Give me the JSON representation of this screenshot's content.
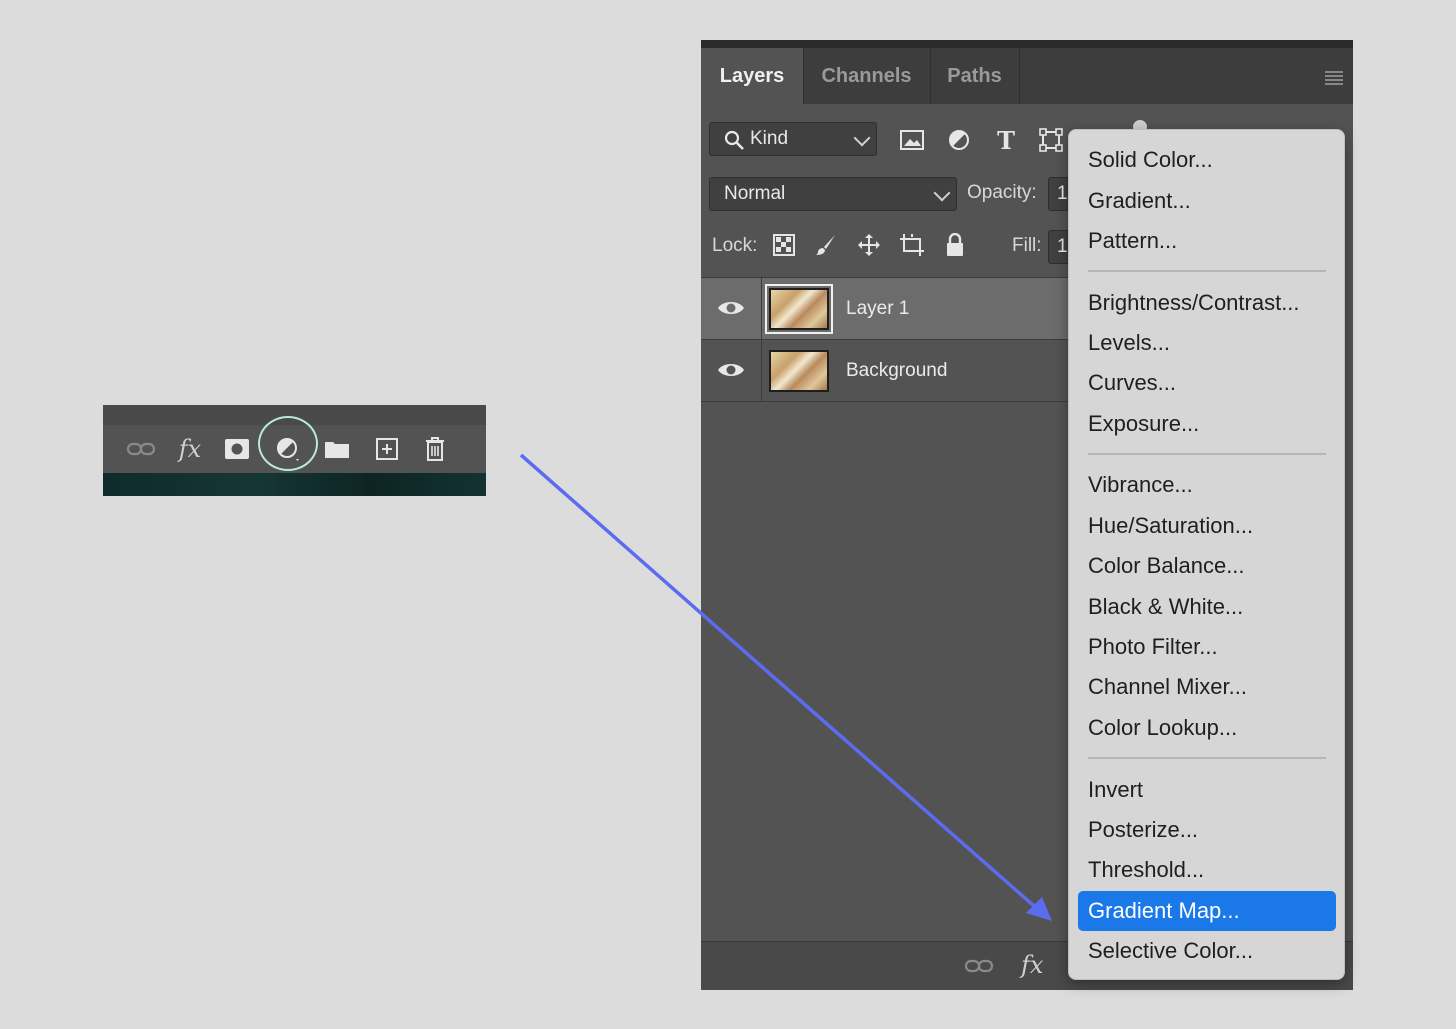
{
  "colors": {
    "arrow": "#5b6cf0",
    "highlight_ring": "#b6ead9",
    "menu_highlight": "#1b78e8",
    "panel_bg": "#535353"
  },
  "mini_toolbar": {
    "icons": [
      "link-layers-icon",
      "fx-icon",
      "mask-icon",
      "adjustment-layer-icon",
      "folder-icon",
      "new-layer-icon",
      "trash-icon"
    ],
    "fx_label": "fx",
    "highlighted_icon": "adjustment-layer-icon"
  },
  "panel": {
    "tabs": [
      {
        "label": "Layers",
        "active": true
      },
      {
        "label": "Channels",
        "active": false
      },
      {
        "label": "Paths",
        "active": false
      }
    ],
    "filter": {
      "kind_label": "Kind",
      "icons": [
        "image-filter-icon",
        "adjustment-filter-icon",
        "type-filter-icon",
        "shape-filter-icon"
      ]
    },
    "blend_mode": "Normal",
    "opacity_label": "Opacity:",
    "opacity_value": "1",
    "lock_label": "Lock:",
    "lock_icons": [
      "lock-transparent-icon",
      "lock-paint-icon",
      "lock-move-icon",
      "lock-artboard-icon",
      "lock-all-icon"
    ],
    "fill_label": "Fill:",
    "fill_value": "1",
    "layers": [
      {
        "name": "Layer 1",
        "visible": true,
        "selected": true
      },
      {
        "name": "Background",
        "visible": true,
        "selected": false
      }
    ],
    "footer_fx": "fx"
  },
  "menu": {
    "groups": [
      [
        "Solid Color...",
        "Gradient...",
        "Pattern..."
      ],
      [
        "Brightness/Contrast...",
        "Levels...",
        "Curves...",
        "Exposure..."
      ],
      [
        "Vibrance...",
        "Hue/Saturation...",
        "Color Balance...",
        "Black & White...",
        "Photo Filter...",
        "Channel Mixer...",
        "Color Lookup..."
      ],
      [
        "Invert",
        "Posterize...",
        "Threshold...",
        "Gradient Map...",
        "Selective Color..."
      ]
    ],
    "highlighted": "Gradient Map..."
  }
}
